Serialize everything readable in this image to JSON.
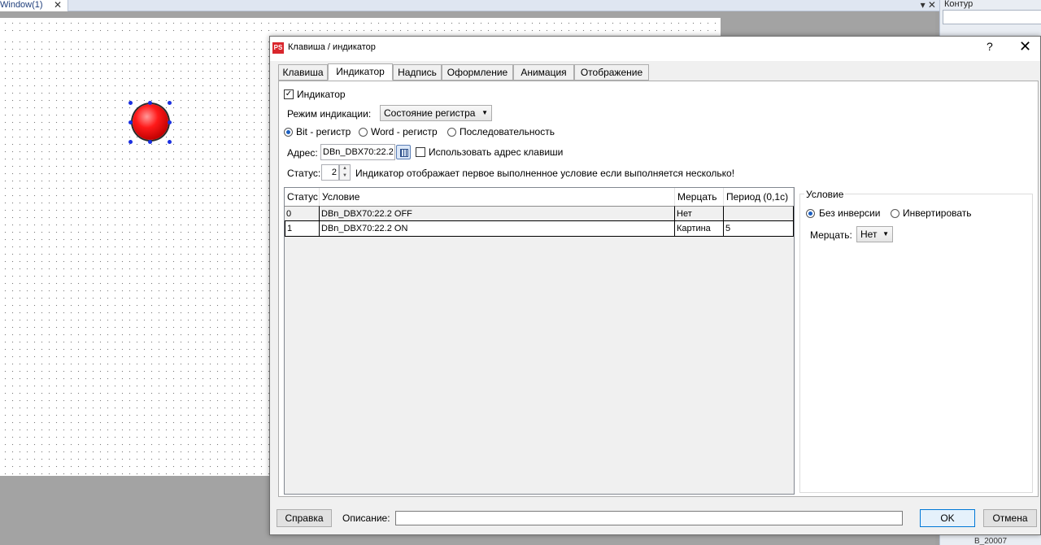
{
  "editor": {
    "doc_tab": "Window(1)",
    "close_symbol": "✕",
    "tabbar_controls": "▾ ✕"
  },
  "right_panel": {
    "title": "Контур",
    "bottom_item": "B_20007"
  },
  "dialog": {
    "title": "Клавиша / индикатор",
    "app_icon": "PS",
    "help_symbol": "?",
    "close_symbol": "✕",
    "tabs": [
      "Клавиша",
      "Индикатор",
      "Надпись",
      "Оформление",
      "Анимация",
      "Отображение"
    ],
    "indicator_checkbox_label": "Индикатор",
    "mode_label": "Режим индикации:",
    "mode_value": "Состояние регистра",
    "radio_bit": "Bit - регистр",
    "radio_word": "Word - регистр",
    "radio_sequence": "Последовательность",
    "address_label": "Адрес:",
    "address_value": "DBn_DBX70:22.2",
    "use_key_address_label": "Использовать адрес клавиши",
    "status_label": "Статус:",
    "status_value": "2",
    "status_hint": "Индикатор отображает первое выполненное условие если выполняется несколько!",
    "table": {
      "headers": [
        "Статус",
        "Условие",
        "Мерцать",
        "Период (0,1с)"
      ],
      "rows": [
        [
          "0",
          "DBn_DBX70:22.2 OFF",
          "Нет",
          ""
        ],
        [
          "1",
          "DBn_DBX70:22.2 ON",
          "Картина",
          "5"
        ]
      ]
    },
    "condition": {
      "title": "Условие",
      "radio_no_inversion": "Без инверсии",
      "radio_invert": "Инвертировать",
      "blink_label": "Мерцать:",
      "blink_value": "Нет"
    },
    "help_button": "Справка",
    "description_label": "Описание:",
    "description_value": "",
    "ok_button": "OK",
    "cancel_button": "Отмена"
  }
}
